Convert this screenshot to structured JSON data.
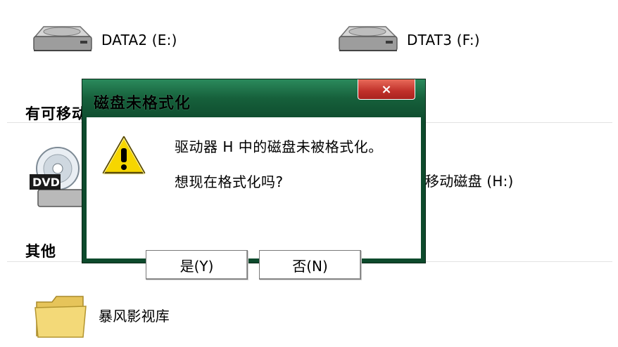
{
  "drives": [
    {
      "name": "DATA2 (E:)",
      "icon": "hard-drive-icon"
    },
    {
      "name": "DTAT3 (F:)",
      "icon": "hard-drive-icon"
    }
  ],
  "removable_section": {
    "title": "有可移动",
    "dvd_badge": "DVD",
    "removable_drive_label": "移动磁盘 (H:)"
  },
  "other_section": {
    "title": "其他",
    "folder_label": "暴风影视库"
  },
  "dialog": {
    "title": "磁盘未格式化",
    "close_glyph": "×",
    "message_line1": "驱动器 H 中的磁盘未被格式化。",
    "message_line2": "想现在格式化吗?",
    "yes_label": "是(Y)",
    "no_label": "否(N)"
  }
}
